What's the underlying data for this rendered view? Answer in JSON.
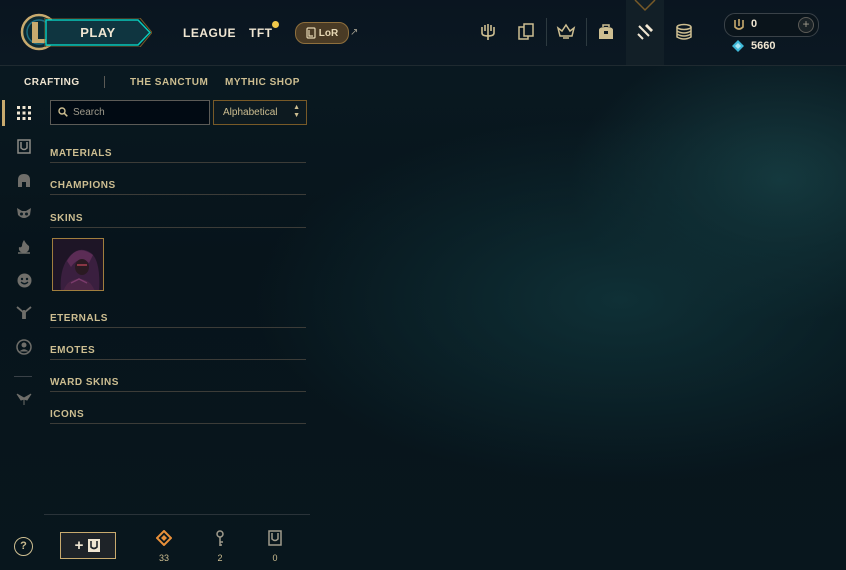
{
  "topbar": {
    "play_label": "PLAY",
    "nav": [
      {
        "label": "LEAGUE"
      },
      {
        "label": "TFT"
      }
    ],
    "lor_label": "LoR",
    "icons": [
      "trident-icon",
      "cards-icon",
      "ranked-icon",
      "backpack-icon",
      "crafting-hammer-icon",
      "coins-stack-icon"
    ],
    "wallet": {
      "rp_value": "0",
      "be_value": "5660"
    }
  },
  "subnav": {
    "tabs": [
      {
        "label": "CRAFTING",
        "active": true
      },
      {
        "label": "THE SANCTUM",
        "active": false
      },
      {
        "label": "MYTHIC SHOP",
        "active": false
      }
    ]
  },
  "filters": {
    "search_placeholder": "Search",
    "sort_value": "Alphabetical"
  },
  "sidebar_icons": [
    "grid-icon",
    "chest-icon",
    "champion-helmet-icon",
    "skin-mask-icon",
    "ward-flame-icon",
    "emote-face-icon",
    "eternals-icon",
    "profile-icon-icon",
    "tft-icon"
  ],
  "sections": [
    {
      "label": "MATERIALS"
    },
    {
      "label": "CHAMPIONS"
    },
    {
      "label": "SKINS"
    },
    {
      "label": "ETERNALS"
    },
    {
      "label": "EMOTES"
    },
    {
      "label": "WARD SKINS"
    },
    {
      "label": "ICONS"
    }
  ],
  "bottom": {
    "help_label": "?",
    "add_label": "+",
    "loot": [
      {
        "icon": "orange-essence-icon",
        "count": "33"
      },
      {
        "icon": "key-icon",
        "count": "2"
      },
      {
        "icon": "chest-icon",
        "count": "0"
      }
    ]
  },
  "colors": {
    "gold": "#c8aa6e",
    "text": "#cdbe91",
    "orange_essence": "#e8903a",
    "blue_essence": "#3fb8d8"
  }
}
